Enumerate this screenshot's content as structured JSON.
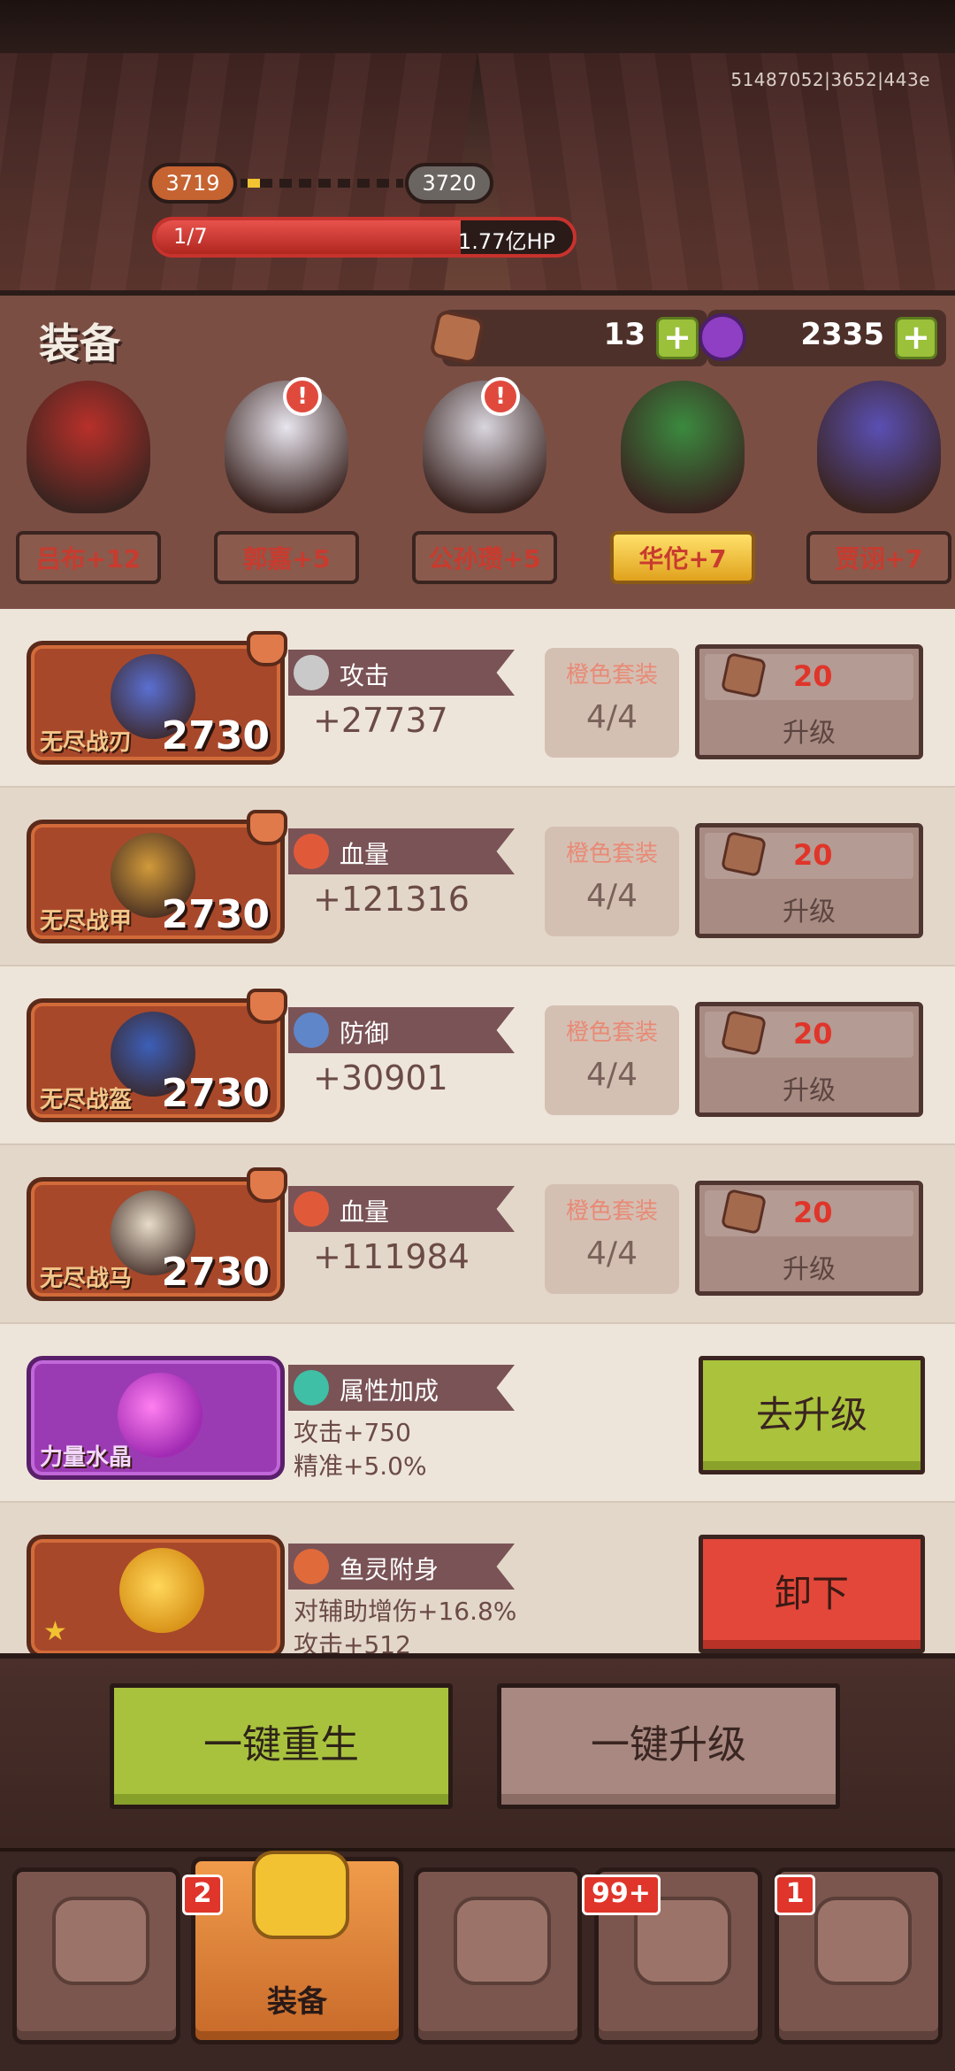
{
  "top": {
    "version_text": "51487052|3652|443e",
    "current_level": "3719",
    "next_level": "3720",
    "wave": "1/7",
    "boss_hp": "1.77亿HP",
    "hp_fraction": 0.73
  },
  "equip": {
    "title": "装备",
    "ore_count": "13",
    "gem_count": "2335",
    "heroes": [
      {
        "name": "吕布+12",
        "color": "#b8302a",
        "alert": false,
        "selected": false
      },
      {
        "name": "郭嘉+5",
        "color": "#e9e6ef",
        "alert": true,
        "selected": false
      },
      {
        "name": "公孙瓒+5",
        "color": "#d9d6de",
        "alert": true,
        "selected": false
      },
      {
        "name": "华佗+7",
        "color": "#3b8a3f",
        "alert": false,
        "selected": true
      },
      {
        "name": "贾诩+7",
        "color": "#5a4fb3",
        "alert": false,
        "selected": false
      }
    ]
  },
  "items": [
    {
      "name": "无尽战刃",
      "level": "2730",
      "stat": "攻击",
      "value": "+27737",
      "set_label": "橙色套装",
      "set_count": "4/4",
      "cost": "20",
      "upgrade": "升级",
      "icon_color": "#5a6fd1",
      "stat_icon": "#c9c9c9"
    },
    {
      "name": "无尽战甲",
      "level": "2730",
      "stat": "血量",
      "value": "+121316",
      "set_label": "橙色套装",
      "set_count": "4/4",
      "cost": "20",
      "upgrade": "升级",
      "icon_color": "#d19a3a",
      "stat_icon": "#e05a3a"
    },
    {
      "name": "无尽战盔",
      "level": "2730",
      "stat": "防御",
      "value": "+30901",
      "set_label": "橙色套装",
      "set_count": "4/4",
      "cost": "20",
      "upgrade": "升级",
      "icon_color": "#3c5fb8",
      "stat_icon": "#5f86c9"
    },
    {
      "name": "无尽战马",
      "level": "2730",
      "stat": "血量",
      "value": "+111984",
      "set_label": "橙色套装",
      "set_count": "4/4",
      "cost": "20",
      "upgrade": "升级",
      "icon_color": "#e7dcc8",
      "stat_icon": "#e05a3a"
    }
  ],
  "crystal": {
    "name": "力量水晶",
    "stat": "属性加成",
    "lines": [
      "攻击+750",
      "精准+5.0%"
    ],
    "button": "去升级"
  },
  "spirit": {
    "stat": "鱼灵附身",
    "lines": [
      "对辅助增伤+16.8%",
      "攻击+512"
    ],
    "button": "卸下"
  },
  "actions": {
    "rebirth": "一键重生",
    "upgrade_all": "一键升级"
  },
  "nav": {
    "items": [
      {
        "label": "",
        "badge": "",
        "active": false
      },
      {
        "label": "装备",
        "badge": "2",
        "active": true
      },
      {
        "label": "",
        "badge": "",
        "active": false
      },
      {
        "label": "",
        "badge": "99+",
        "active": false
      },
      {
        "label": "",
        "badge": "1",
        "active": false
      }
    ]
  }
}
